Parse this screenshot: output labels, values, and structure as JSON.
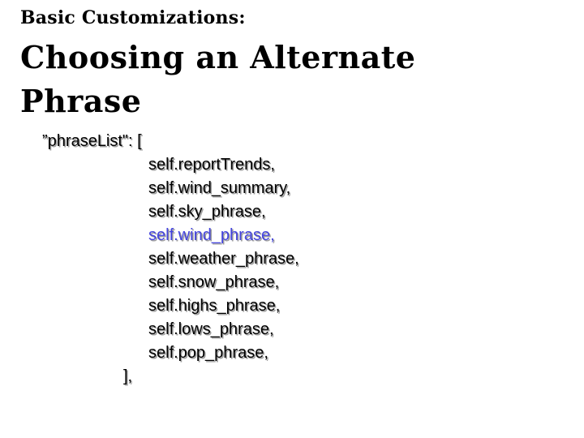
{
  "slide": {
    "subtitle": "Basic Customizations:",
    "title_lines": [
      "Choosing an Alternate",
      "Phrase"
    ]
  },
  "code": {
    "open_line": "”phraseList\": [",
    "items": [
      {
        "text": "self.reportTrends,",
        "highlighted": false
      },
      {
        "text": "self.wind_summary,",
        "highlighted": false
      },
      {
        "text": "self.sky_phrase,",
        "highlighted": false
      },
      {
        "text": "self.wind_phrase,",
        "highlighted": true
      },
      {
        "text": "self.weather_phrase,",
        "highlighted": false
      },
      {
        "text": "self.snow_phrase,",
        "highlighted": false
      },
      {
        "text": "self.highs_phrase,",
        "highlighted": false
      },
      {
        "text": "self.lows_phrase,",
        "highlighted": false
      },
      {
        "text": "self.pop_phrase,",
        "highlighted": false
      }
    ],
    "close_line": "],"
  },
  "colors": {
    "text": "#000000",
    "highlight": "#4444dd",
    "background": "#ffffff"
  }
}
